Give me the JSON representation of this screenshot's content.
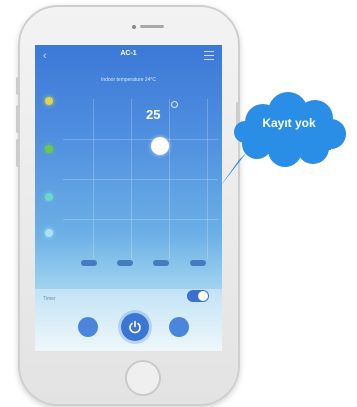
{
  "app": {
    "device_name": "AC-1",
    "subtitle": "Indoor temperature 24°C"
  },
  "thermostat": {
    "set_temperature": "25"
  },
  "mode_dots": [
    {
      "name": "mode-dot-yellow",
      "color": "#d9d74a"
    },
    {
      "name": "mode-dot-green",
      "color": "#6cc84a"
    },
    {
      "name": "mode-dot-teal",
      "color": "#6fd6c8"
    },
    {
      "name": "mode-dot-lightblue",
      "color": "#a9e3f4"
    }
  ],
  "schedule": {
    "label": "Timer",
    "toggle_on": true
  },
  "callout": {
    "text": "Kayıt yok"
  },
  "colors": {
    "accent": "#3a76d6",
    "callout_bg": "#2a8ee6"
  },
  "icons": [
    "back-icon",
    "menu-icon",
    "power-icon",
    "temperature-unit-icon"
  ]
}
